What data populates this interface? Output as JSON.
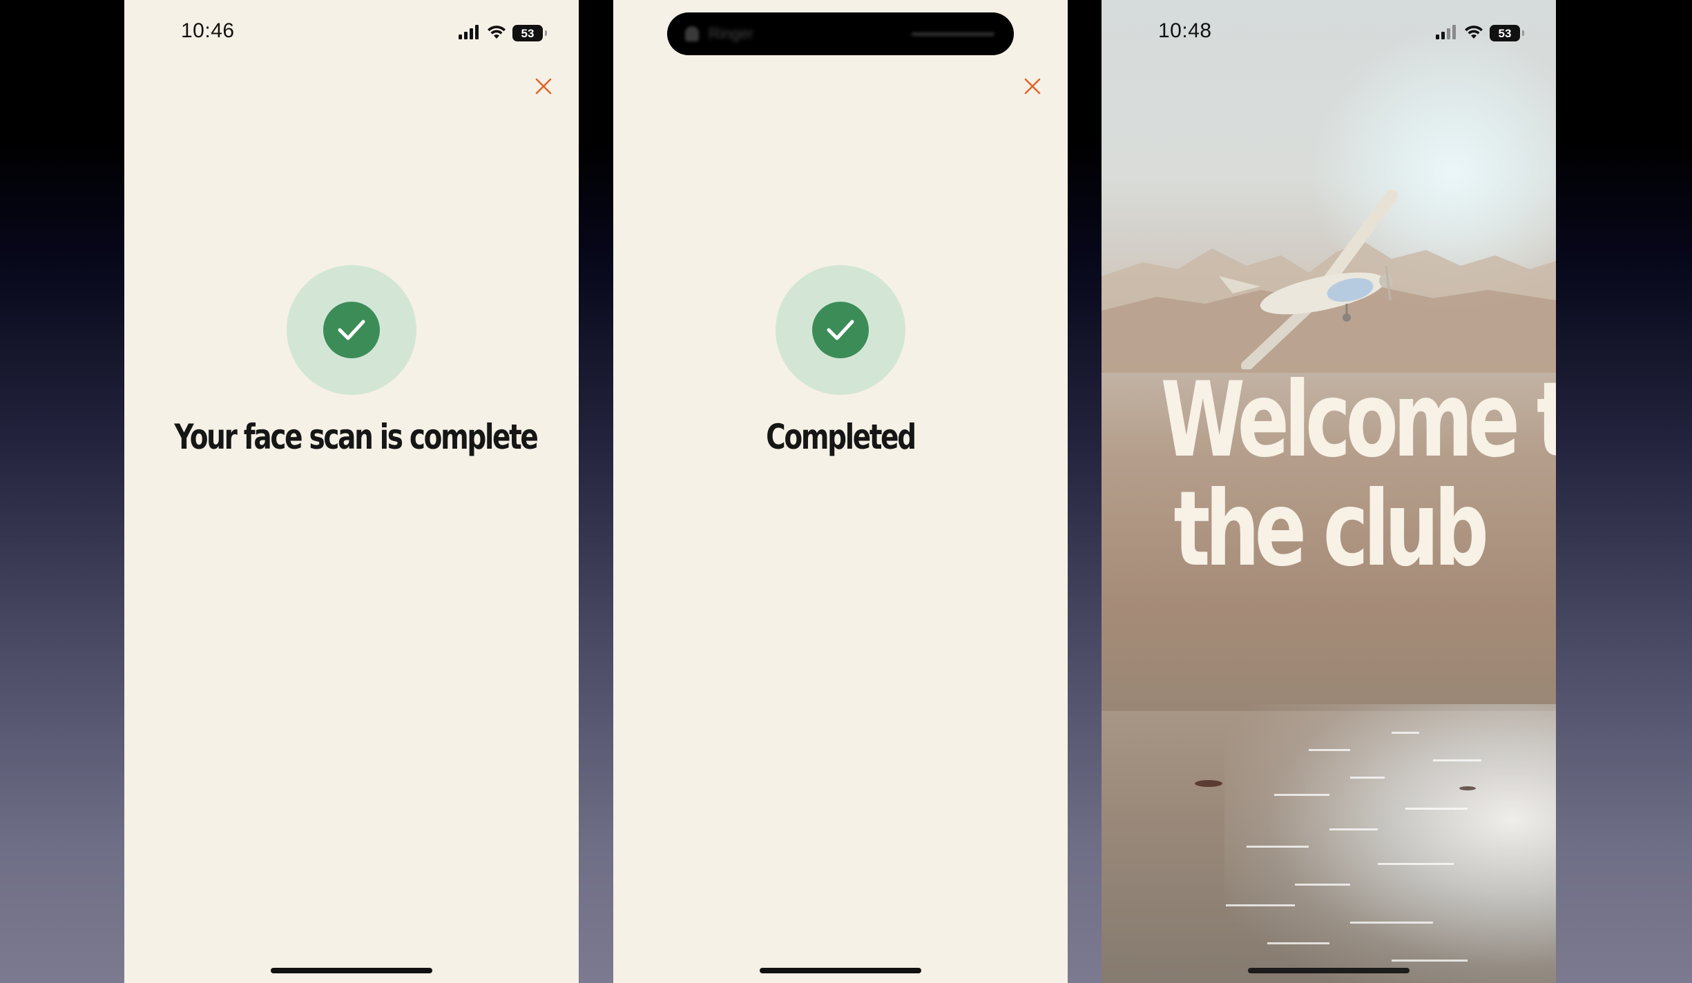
{
  "screens": [
    {
      "status": {
        "time": "10:46",
        "battery": "53"
      },
      "headline": "Your face scan is complete"
    },
    {
      "dynamic_island": {
        "label": "Ringer"
      },
      "headline": "Completed"
    },
    {
      "status": {
        "time": "10:48",
        "battery": "53"
      },
      "headline_line1": "Welcome to",
      "headline_line2": "the club"
    }
  ],
  "colors": {
    "background_cream": "#f6f1e6",
    "check_ring": "#d3e6d6",
    "check_fill": "#3c8c58",
    "close_icon": "#e0662a",
    "headline_text": "#161616",
    "welcome_text": "#f7f1e6"
  },
  "icons": [
    "signal-icon",
    "wifi-icon",
    "battery-icon",
    "close-icon",
    "checkmark-icon",
    "bell-icon"
  ]
}
